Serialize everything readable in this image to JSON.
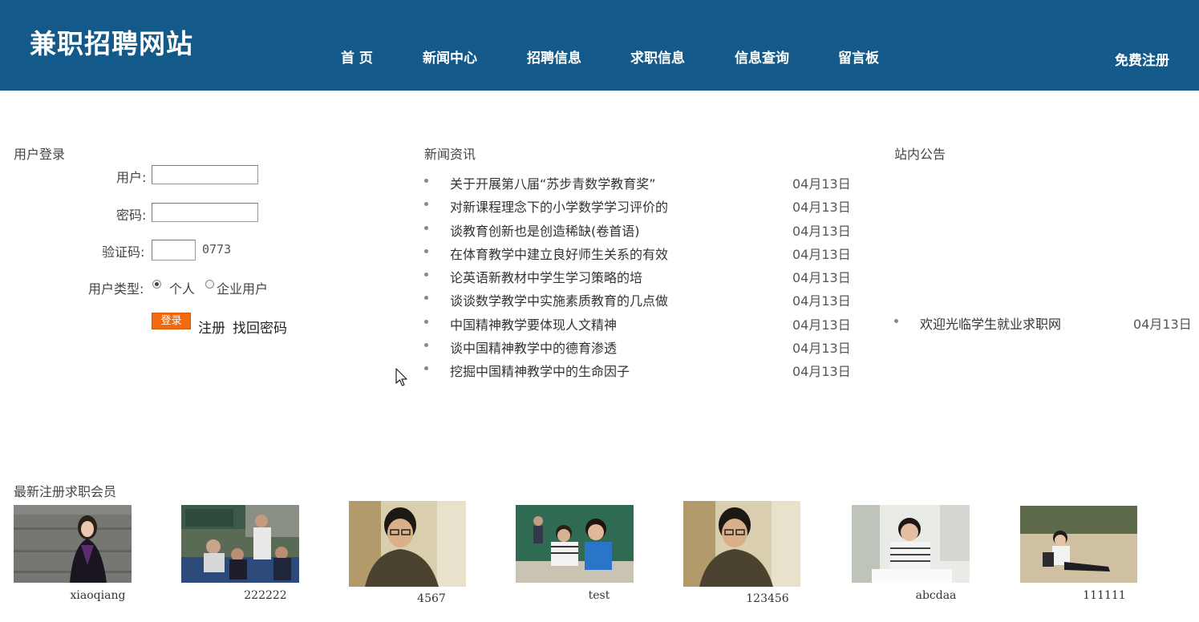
{
  "header": {
    "site_title": "兼职招聘网站",
    "nav": [
      "首 页",
      "新闻中心",
      "招聘信息",
      "求职信息",
      "信息查询",
      "留言板"
    ],
    "register": "免费注册",
    "bg_color": "#135a8a"
  },
  "login": {
    "title": "用户登录",
    "user_label": "用户:",
    "password_label": "密码:",
    "captcha_label": "验证码:",
    "captcha_value": "0773",
    "type_label": "用户类型:",
    "type_options": [
      "个人",
      "企业用户"
    ],
    "type_selected": "个人",
    "login_button": "登录",
    "register_link": "注册",
    "recover_link": "找回密码"
  },
  "news": {
    "title": "新闻资讯",
    "items": [
      {
        "title": "关于开展第八届“苏步青数学教育奖”",
        "date": "04月13日"
      },
      {
        "title": "对新课程理念下的小学数学学习评价的",
        "date": "04月13日"
      },
      {
        "title": "谈教育创新也是创造稀缺(卷首语)",
        "date": "04月13日"
      },
      {
        "title": "在体育教学中建立良好师生关系的有效",
        "date": "04月13日"
      },
      {
        "title": "论英语新教材中学生学习策略的培",
        "date": "04月13日"
      },
      {
        "title": "谈谈数学教学中实施素质教育的几点做",
        "date": "04月13日"
      },
      {
        "title": "中国精神教学要体现人文精神",
        "date": "04月13日"
      },
      {
        "title": "谈中国精神教学中的德育渗透",
        "date": "04月13日"
      },
      {
        "title": "挖掘中国精神教学中的生命因子",
        "date": "04月13日"
      }
    ]
  },
  "notice": {
    "title": "站内公告",
    "items": [
      {
        "title": "欢迎光临学生就业求职网",
        "date": "04月13日"
      }
    ]
  },
  "members": {
    "title": "最新注册求职会员",
    "items": [
      {
        "name": "xiaoqiang",
        "photo": "graduate-woman"
      },
      {
        "name": "222222",
        "photo": "classroom-group"
      },
      {
        "name": "4567",
        "photo": "young-man-glasses"
      },
      {
        "name": "test",
        "photo": "students-classroom"
      },
      {
        "name": "123456",
        "photo": "young-man-glasses"
      },
      {
        "name": "abcdaa",
        "photo": "man-reading"
      },
      {
        "name": "111111",
        "photo": "woman-sitting-outdoors"
      }
    ]
  }
}
